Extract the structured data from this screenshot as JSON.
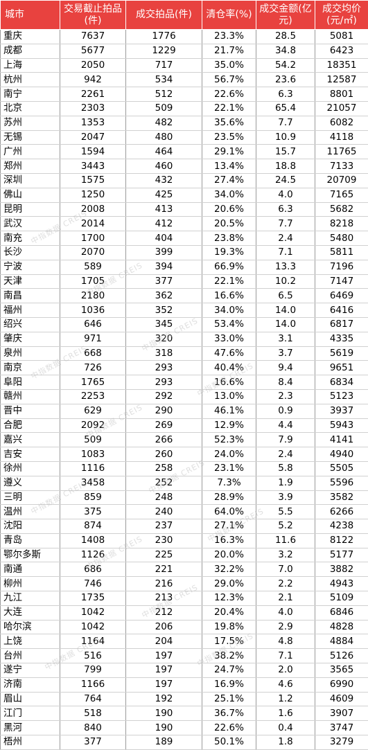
{
  "headers": [
    "城市",
    "交易截止拍品(件)",
    "成交拍品(件)",
    "清仓率(%)",
    "成交金额(亿元)",
    "成交均价(元/㎡)"
  ],
  "rows": [
    [
      "重庆",
      "7637",
      "1776",
      "23.3%",
      "28.5",
      "5081"
    ],
    [
      "成都",
      "5677",
      "1229",
      "21.7%",
      "34.8",
      "6423"
    ],
    [
      "上海",
      "2050",
      "717",
      "35.0%",
      "54.2",
      "18351"
    ],
    [
      "杭州",
      "942",
      "534",
      "56.7%",
      "23.6",
      "12587"
    ],
    [
      "南宁",
      "2261",
      "512",
      "22.6%",
      "6.3",
      "8801"
    ],
    [
      "北京",
      "2303",
      "509",
      "22.1%",
      "65.4",
      "21057"
    ],
    [
      "苏州",
      "1353",
      "482",
      "35.6%",
      "7.7",
      "6082"
    ],
    [
      "无锡",
      "2047",
      "480",
      "23.5%",
      "10.9",
      "4118"
    ],
    [
      "广州",
      "1594",
      "464",
      "29.1%",
      "15.7",
      "11765"
    ],
    [
      "郑州",
      "3443",
      "460",
      "13.4%",
      "18.8",
      "7133"
    ],
    [
      "深圳",
      "1575",
      "432",
      "27.4%",
      "24.5",
      "20709"
    ],
    [
      "佛山",
      "1250",
      "425",
      "34.0%",
      "4.0",
      "7165"
    ],
    [
      "昆明",
      "2008",
      "413",
      "20.6%",
      "6.3",
      "5682"
    ],
    [
      "武汉",
      "2014",
      "412",
      "20.5%",
      "7.7",
      "8218"
    ],
    [
      "南充",
      "1700",
      "404",
      "23.8%",
      "2.4",
      "5480"
    ],
    [
      "长沙",
      "2070",
      "399",
      "19.3%",
      "7.1",
      "5811"
    ],
    [
      "宁波",
      "589",
      "394",
      "66.9%",
      "13.3",
      "7196"
    ],
    [
      "天津",
      "1705",
      "377",
      "22.1%",
      "10.2",
      "7147"
    ],
    [
      "南昌",
      "2180",
      "362",
      "16.6%",
      "6.5",
      "6469"
    ],
    [
      "福州",
      "1036",
      "352",
      "34.0%",
      "14.0",
      "6416"
    ],
    [
      "绍兴",
      "646",
      "345",
      "53.4%",
      "14.0",
      "6817"
    ],
    [
      "肇庆",
      "971",
      "320",
      "33.0%",
      "3.1",
      "4335"
    ],
    [
      "泉州",
      "668",
      "318",
      "47.6%",
      "3.7",
      "5619"
    ],
    [
      "南京",
      "726",
      "293",
      "40.4%",
      "9.4",
      "9651"
    ],
    [
      "阜阳",
      "1765",
      "293",
      "16.6%",
      "8.4",
      "6834"
    ],
    [
      "赣州",
      "2253",
      "292",
      "13.0%",
      "2.3",
      "5123"
    ],
    [
      "晋中",
      "629",
      "290",
      "46.1%",
      "0.9",
      "3937"
    ],
    [
      "合肥",
      "2092",
      "269",
      "12.9%",
      "4.4",
      "5943"
    ],
    [
      "嘉兴",
      "509",
      "266",
      "52.3%",
      "7.9",
      "4141"
    ],
    [
      "吉安",
      "1083",
      "260",
      "24.0%",
      "2.4",
      "4940"
    ],
    [
      "徐州",
      "1116",
      "258",
      "23.1%",
      "5.8",
      "5505"
    ],
    [
      "遵义",
      "3458",
      "252",
      "7.3%",
      "1.9",
      "5596"
    ],
    [
      "三明",
      "859",
      "248",
      "28.9%",
      "3.9",
      "3582"
    ],
    [
      "温州",
      "375",
      "240",
      "64.0%",
      "5.5",
      "6266"
    ],
    [
      "沈阳",
      "874",
      "237",
      "27.1%",
      "5.2",
      "4238"
    ],
    [
      "青岛",
      "1408",
      "230",
      "16.3%",
      "11.6",
      "8122"
    ],
    [
      "鄂尔多斯",
      "1126",
      "225",
      "20.0%",
      "3.2",
      "5177"
    ],
    [
      "南通",
      "686",
      "221",
      "32.2%",
      "7.0",
      "3882"
    ],
    [
      "柳州",
      "746",
      "216",
      "29.0%",
      "2.2",
      "4943"
    ],
    [
      "九江",
      "1735",
      "213",
      "12.3%",
      "2.1",
      "5109"
    ],
    [
      "大连",
      "1042",
      "212",
      "20.4%",
      "4.0",
      "6846"
    ],
    [
      "哈尔滨",
      "1042",
      "206",
      "19.8%",
      "2.9",
      "4828"
    ],
    [
      "上饶",
      "1164",
      "204",
      "17.5%",
      "4.8",
      "4884"
    ],
    [
      "台州",
      "516",
      "197",
      "38.2%",
      "7.1",
      "5126"
    ],
    [
      "遂宁",
      "799",
      "197",
      "24.7%",
      "2.0",
      "3565"
    ],
    [
      "济南",
      "1166",
      "197",
      "16.9%",
      "4.6",
      "6990"
    ],
    [
      "眉山",
      "764",
      "192",
      "25.1%",
      "1.2",
      "4609"
    ],
    [
      "江门",
      "518",
      "190",
      "36.7%",
      "1.6",
      "3907"
    ],
    [
      "黑河",
      "840",
      "190",
      "22.6%",
      "0.4",
      "3747"
    ],
    [
      "梧州",
      "377",
      "189",
      "50.1%",
      "1.8",
      "3279"
    ]
  ],
  "group_starts": [
    11,
    20,
    28,
    37,
    45
  ],
  "watermark": "中指数据 CREIS",
  "colors": {
    "header_bg": "#e8423f",
    "header_text": "#ffffff",
    "divider": "#4a7fb8"
  }
}
